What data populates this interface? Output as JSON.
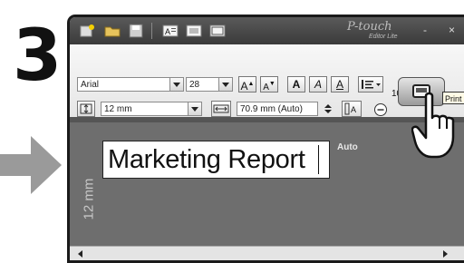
{
  "step": {
    "number": "3"
  },
  "window": {
    "brand": "P-touch",
    "brand_sub": "Editor Lite",
    "controls": [
      "-",
      "×"
    ]
  },
  "toolbar": {
    "font_name": "Arial",
    "font_size": "28",
    "label_width": "12 mm",
    "label_length": "70.9 mm (Auto)",
    "zoom": "100 %",
    "print_tooltip": "Print",
    "format_buttons": [
      "A",
      "A",
      "A",
      "A",
      "A"
    ]
  },
  "canvas": {
    "tape_width": "12 mm",
    "auto_label": "Auto",
    "label_text": "Marketing Report"
  },
  "colors": {
    "titlebar": "#4a4a4a",
    "canvas_bg": "#6e6e6e",
    "arrow": "#9a9a9a"
  }
}
